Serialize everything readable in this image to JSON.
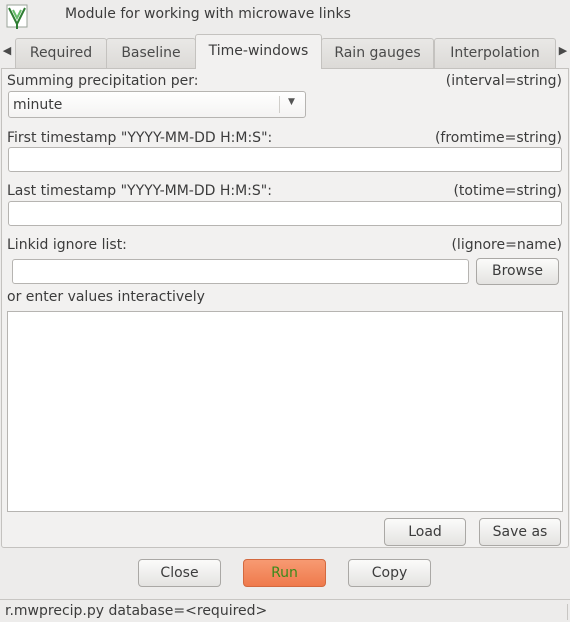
{
  "window": {
    "title": "Module for working with microwave links"
  },
  "tabs": [
    {
      "label": "Required"
    },
    {
      "label": "Baseline"
    },
    {
      "label": "Time-windows"
    },
    {
      "label": "Rain gauges"
    },
    {
      "label": "Interpolation"
    }
  ],
  "active_tab": "Time-windows",
  "form": {
    "interval": {
      "label": "Summing precipitation per:",
      "hint": "(interval=string)",
      "value": "minute"
    },
    "fromtime": {
      "label": "First timestamp \"YYYY-MM-DD H:M:S\":",
      "hint": "(fromtime=string)",
      "value": ""
    },
    "totime": {
      "label": "Last timestamp \"YYYY-MM-DD H:M:S\":",
      "hint": "(totime=string)",
      "value": ""
    },
    "lignore": {
      "label": "Linkid ignore list:",
      "hint": "(lignore=name)",
      "value": "",
      "browse_label": "Browse",
      "interactive_label": "or enter values interactively",
      "interactive_value": ""
    }
  },
  "panel_buttons": {
    "load": "Load",
    "save_as": "Save as"
  },
  "footer_buttons": {
    "close": "Close",
    "run": "Run",
    "copy": "Copy"
  },
  "colors": {
    "run_bg": "#ef7a4c",
    "run_text": "#3a8a1a"
  },
  "status": {
    "command": "r.mwprecip.py database=<required>"
  }
}
